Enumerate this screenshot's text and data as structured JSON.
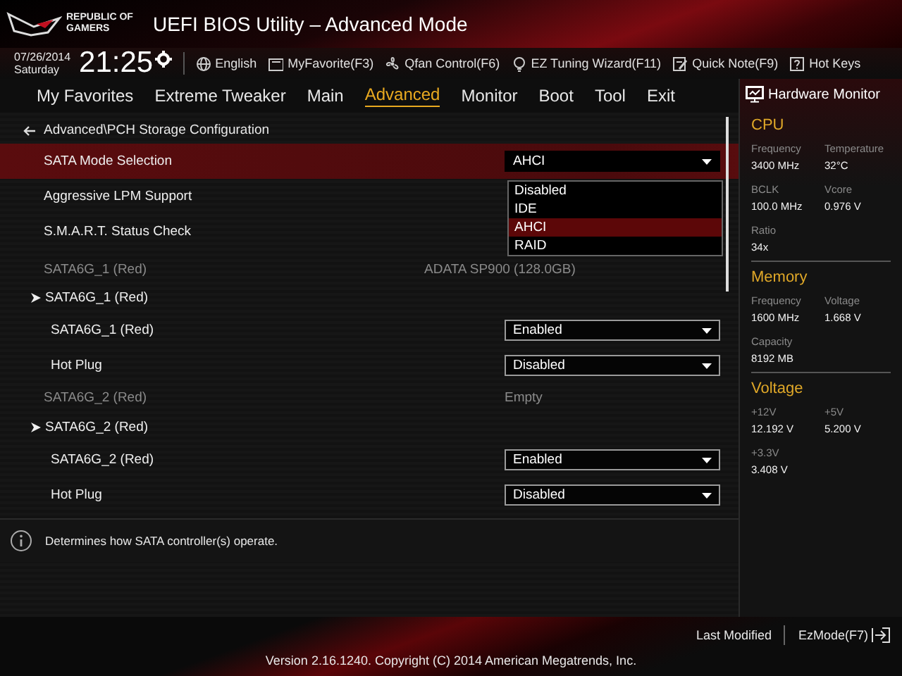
{
  "header": {
    "logo_lines": [
      "REPUBLIC OF",
      "GAMERS"
    ],
    "title": "UEFI BIOS Utility – Advanced Mode"
  },
  "toolbar": {
    "date": "07/26/2014",
    "day": "Saturday",
    "time": "21:25",
    "items": [
      {
        "label": "English"
      },
      {
        "label": "MyFavorite(F3)"
      },
      {
        "label": "Qfan Control(F6)"
      },
      {
        "label": "EZ Tuning Wizard(F11)"
      },
      {
        "label": "Quick Note(F9)"
      },
      {
        "label": "Hot Keys"
      }
    ]
  },
  "tabs": [
    {
      "label": "My Favorites",
      "selected": false
    },
    {
      "label": "Extreme Tweaker",
      "selected": false
    },
    {
      "label": "Main",
      "selected": false
    },
    {
      "label": "Advanced",
      "selected": true
    },
    {
      "label": "Monitor",
      "selected": false
    },
    {
      "label": "Boot",
      "selected": false
    },
    {
      "label": "Tool",
      "selected": false
    },
    {
      "label": "Exit",
      "selected": false
    }
  ],
  "breadcrumb": "Advanced\\PCH Storage Configuration",
  "rows": [
    {
      "kind": "select",
      "label": "SATA Mode Selection",
      "value": "AHCI",
      "selected": true,
      "options": [
        {
          "label": "Disabled",
          "selected": false
        },
        {
          "label": "IDE",
          "selected": false
        },
        {
          "label": "AHCI",
          "selected": true
        },
        {
          "label": "RAID",
          "selected": false
        }
      ]
    },
    {
      "kind": "select",
      "label": "Aggressive LPM Support",
      "selected": false
    },
    {
      "kind": "select",
      "label": "S.M.A.R.T. Status Check",
      "selected": false
    },
    {
      "kind": "info",
      "label": "SATA6G_1 (Red)",
      "value": "ADATA SP900 (128.0GB)",
      "selected": false
    },
    {
      "kind": "submenu",
      "label": "SATA6G_1 (Red)",
      "selected": false,
      "children": [
        {
          "kind": "select",
          "label": "SATA6G_1 (Red)",
          "value": "Enabled",
          "selected": false
        },
        {
          "kind": "select",
          "label": "Hot Plug",
          "value": "Disabled",
          "selected": false
        }
      ]
    },
    {
      "kind": "info",
      "label": "SATA6G_2 (Red)",
      "value": "Empty",
      "selected": false
    },
    {
      "kind": "submenu",
      "label": "SATA6G_2 (Red)",
      "selected": false,
      "children": [
        {
          "kind": "select",
          "label": "SATA6G_2 (Red)",
          "value": "Enabled",
          "selected": false
        },
        {
          "kind": "select",
          "label": "Hot Plug",
          "value": "Disabled",
          "selected": false
        }
      ]
    }
  ],
  "help": "Determines how SATA controller(s) operate.",
  "monitor": {
    "title": "Hardware Monitor",
    "sections": [
      {
        "title": "CPU",
        "items": [
          {
            "label": "Frequency",
            "value": "3400 MHz"
          },
          {
            "label": "Temperature",
            "value": "32°C"
          },
          {
            "label": "BCLK",
            "value": "100.0 MHz"
          },
          {
            "label": "Vcore",
            "value": "0.976 V"
          },
          {
            "label": "Ratio",
            "value": "34x"
          }
        ]
      },
      {
        "title": "Memory",
        "items": [
          {
            "label": "Frequency",
            "value": "1600 MHz"
          },
          {
            "label": "Voltage",
            "value": "1.668 V"
          },
          {
            "label": "Capacity",
            "value": "8192 MB"
          }
        ]
      },
      {
        "title": "Voltage",
        "items": [
          {
            "label": "+12V",
            "value": "12.192 V"
          },
          {
            "label": "+5V",
            "value": "5.200 V"
          },
          {
            "label": "+3.3V",
            "value": "3.408 V"
          }
        ]
      }
    ]
  },
  "footer": {
    "last_modified": "Last Modified",
    "ezmode": "EzMode(F7)",
    "version": "Version 2.16.1240. Copyright (C) 2014 American Megatrends, Inc."
  }
}
